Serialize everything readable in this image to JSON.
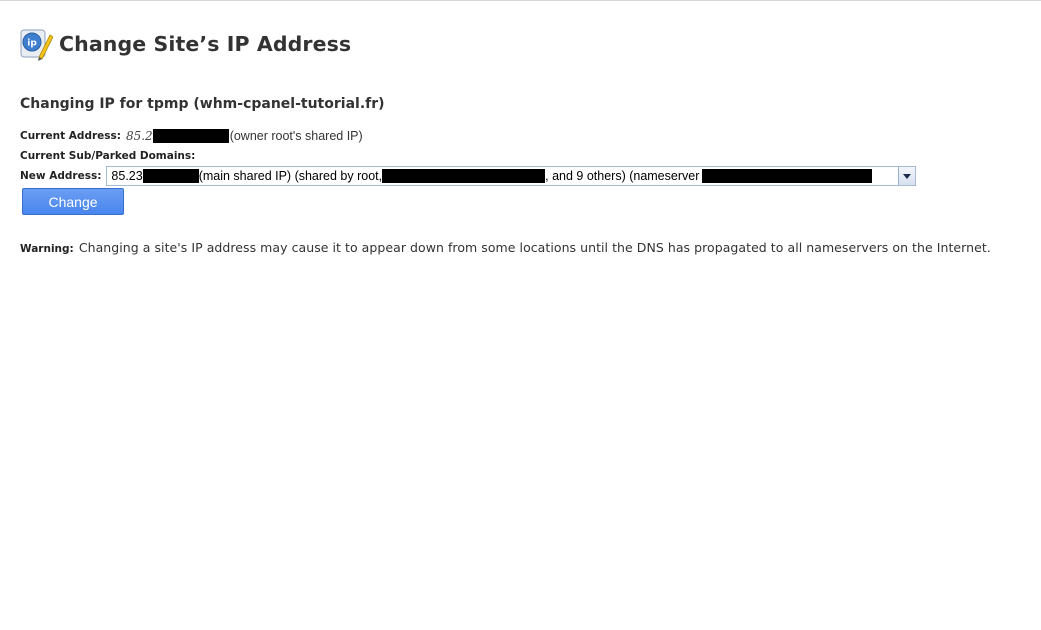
{
  "header": {
    "title": "Change Site’s IP Address",
    "icon": "ip-icon",
    "icon_text": "ip"
  },
  "subtitle": "Changing IP for tpmp (whm-cpanel-tutorial.fr)",
  "current": {
    "label": "Current Address:",
    "value": "85.2",
    "note": "(owner root's shared IP)"
  },
  "domains": {
    "label": "Current Sub/Parked Domains:"
  },
  "new_address": {
    "label": "New Address:",
    "part1": "85.23",
    "part2": "(main shared IP) (shared by root,",
    "part3": ", and 9 others) (nameserver",
    "dropdown_icon": "chevron-down-icon"
  },
  "button": {
    "label": "Change"
  },
  "warning": {
    "label": "Warning:",
    "text": "Changing a site's IP address may cause it to appear down from some locations until the DNS has propagated to all nameservers on the Internet."
  },
  "colors": {
    "button": "#4a86ee",
    "redaction": "#000000"
  }
}
